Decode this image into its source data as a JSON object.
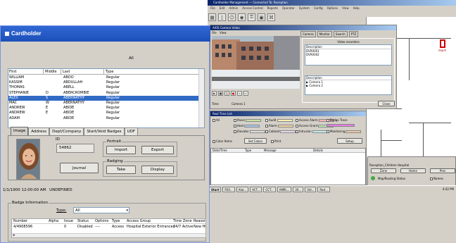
{
  "bg": {
    "app_title": "Cardholder Management — Connected To: Reception",
    "menu": [
      "File",
      "Edit",
      "Admin",
      "Access Control",
      "Reports",
      "Operator",
      "System",
      "Config",
      "Options",
      "View",
      "Help"
    ],
    "camera_window": {
      "title": "AXIS Camera Video",
      "menu": [
        "File",
        "View"
      ],
      "tabs": [
        "Camera",
        "Monitor",
        "Search",
        "PTZ"
      ],
      "video_recorders_label": "Video recorders",
      "description_header": "Description",
      "recorders": [
        "DVR0001",
        "DVR0002"
      ],
      "cameras_header": "Description",
      "cameras": [
        "Camera 1",
        "Camera 2"
      ],
      "time_label": "Time",
      "camera_label": "Camera 1",
      "close_label": "Close"
    },
    "event_window": {
      "title": "Real Time List",
      "checks": [
        "All",
        "Panel",
        "Audit",
        "Access Alarm",
        "Badge Trace",
        "Host",
        "Alarm",
        "Access Grant",
        "Elevator",
        "Cabinet",
        "Intrusion",
        "Monitoring"
      ],
      "colors_label": "Color Items",
      "set_colors_label": "Set Colors",
      "print_label": "Print",
      "setup_label": "Setup",
      "columns": [
        "Date/Time",
        "Type",
        "Message",
        "Details"
      ]
    },
    "reception": {
      "title": "Reception_Children Hospital",
      "zone_btn": "Zone",
      "home_btn": "Home",
      "prev_btn": "Prev",
      "status": "Map/Routing Status",
      "names": "Names"
    },
    "taskbar": {
      "start": "Start",
      "tasks": [
        "P20...",
        "Alar...",
        "ACT...",
        "CCT...",
        "AMPL...",
        "20...",
        "Vid...",
        "Red..."
      ],
      "clock": "4:42 PM"
    }
  },
  "cardholder": {
    "title": "Cardholder",
    "count_text": "All",
    "columns": [
      "First",
      "Middle",
      "Last",
      "Type"
    ],
    "rows": [
      {
        "first": "WILLIAM",
        "middle": "",
        "last": "ABDO",
        "type": "Regular"
      },
      {
        "first": "KASSIM",
        "middle": "",
        "last": "ABDULLAH",
        "type": "Regular"
      },
      {
        "first": "THOMAS",
        "middle": "",
        "last": "ABELL",
        "type": "Regular"
      },
      {
        "first": "STEPHANIE",
        "middle": "D",
        "last": "ABERCROMBIE",
        "type": "Regular"
      },
      {
        "first": "ALEX",
        "middle": "S",
        "last": "ABERNATHY",
        "type": "Regular"
      },
      {
        "first": "MAC",
        "middle": "W",
        "last": "ABERNATHY",
        "type": "Regular"
      },
      {
        "first": "ANDREW",
        "middle": "E",
        "last": "ABIDE",
        "type": "Regular"
      },
      {
        "first": "ANDREW",
        "middle": "E",
        "last": "ABIDE",
        "type": "Regular"
      },
      {
        "first": "ADAM",
        "middle": "",
        "last": "ABIDE",
        "type": "Regular"
      }
    ],
    "selected_index": 4,
    "tabs": [
      "Image",
      "Address",
      "Dept/Company",
      "Start/Void Badges",
      "UDF"
    ],
    "active_tab": "Image",
    "id_label": "ID",
    "id_value": "54862",
    "journal_label": "Journal",
    "portrait_label": "Portrait",
    "import_label": "Import",
    "export_label": "Export",
    "badging_label": "Badging",
    "take_label": "Take",
    "display_label": "Display",
    "timestamp": "1/1/1900 12:00:00 AM",
    "status_text": "UNDEFINED",
    "badge_info_label": "Badge Information",
    "type_label": "Type:",
    "type_value": "All",
    "badge_columns": [
      "Number",
      "Alpha",
      "Issue",
      "Status",
      "Options",
      "Type",
      "Access Group",
      "Time Zone",
      "Reason"
    ],
    "badge_rows": [
      {
        "number": "4/4908596",
        "alpha": "",
        "issue": "0",
        "status": "Disabled",
        "options": "----",
        "type": "Access",
        "group": "Hospital Exterior Entrances",
        "tz": "24/7 Active",
        "reason": "New HI"
      }
    ]
  }
}
